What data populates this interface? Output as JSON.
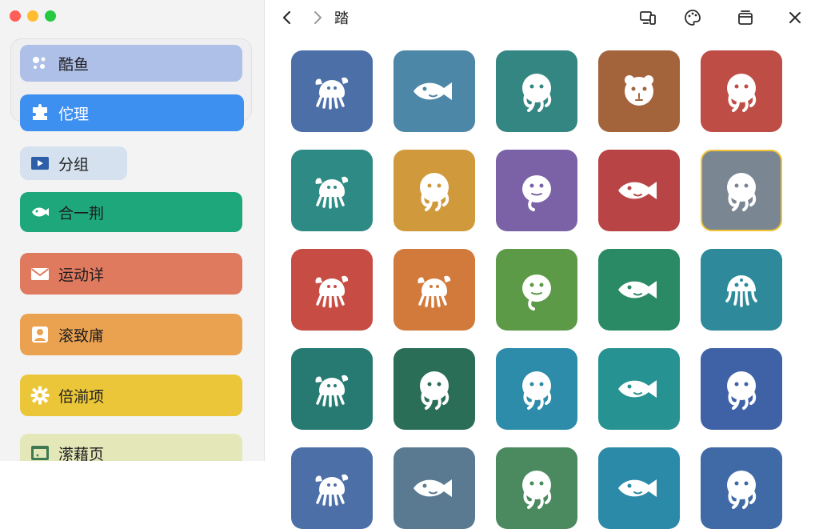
{
  "window": {
    "title": "踏"
  },
  "toolbar": {
    "back_icon": "chevron-left-icon",
    "forward_icon": "chevron-right-icon",
    "title": "踏",
    "actions": [
      {
        "name": "devices-icon"
      },
      {
        "name": "palette-icon"
      },
      {
        "name": "window-icon"
      },
      {
        "name": "close-icon"
      }
    ]
  },
  "sidebar": {
    "items": [
      {
        "label": "酷鱼",
        "icon": "dots-icon",
        "color": "#aec0e8",
        "selected": false
      },
      {
        "label": "佗理",
        "icon": "puzzle-icon",
        "color": "#3d8ff0",
        "selected": true
      },
      {
        "label": "分组",
        "icon": "video-icon",
        "color": "#d5e1ee",
        "selected": false
      },
      {
        "label": "合一荆",
        "icon": "fish-icon",
        "color": "#1fa77c",
        "selected": false
      },
      {
        "label": "运动详",
        "icon": "mail-icon",
        "color": "#e07a5f",
        "selected": false
      },
      {
        "label": "滚致庯",
        "icon": "person-icon",
        "color": "#eba250",
        "selected": false
      },
      {
        "label": "倍湔项",
        "icon": "gear-icon",
        "color": "#ebc638",
        "selected": false
      },
      {
        "label": "潆藉页",
        "icon": "screen-icon",
        "color": "#e4e8b8",
        "selected": false
      }
    ]
  },
  "grid": {
    "tiles": [
      {
        "creature": "crab-icon",
        "color": "#4d6fa8"
      },
      {
        "creature": "fish-icon",
        "color": "#4d87a8"
      },
      {
        "creature": "octopus-icon",
        "color": "#348682"
      },
      {
        "creature": "bear-icon",
        "color": "#a3643c"
      },
      {
        "creature": "octopus-icon",
        "color": "#bd4d45"
      },
      {
        "creature": "crab-icon",
        "color": "#2e8a84"
      },
      {
        "creature": "octopus-icon",
        "color": "#d09a3c"
      },
      {
        "creature": "blob-icon",
        "color": "#7b62a6"
      },
      {
        "creature": "fish-icon",
        "color": "#b84445"
      },
      {
        "creature": "octopus-icon",
        "color": "#7a8793",
        "selected": true
      },
      {
        "creature": "crab-icon",
        "color": "#c74d44"
      },
      {
        "creature": "crab-icon",
        "color": "#d27a3c"
      },
      {
        "creature": "blob-icon",
        "color": "#5c9a48"
      },
      {
        "creature": "fish-icon",
        "color": "#2a8a66"
      },
      {
        "creature": "jellyfish-icon",
        "color": "#2e8a9a"
      },
      {
        "creature": "crab-icon",
        "color": "#267a72"
      },
      {
        "creature": "octopus-icon",
        "color": "#2a6e58"
      },
      {
        "creature": "octopus-icon",
        "color": "#2c8caa"
      },
      {
        "creature": "fish-icon",
        "color": "#279292"
      },
      {
        "creature": "octopus-icon",
        "color": "#3f62a6"
      },
      {
        "creature": "crab-icon",
        "color": "#4d6fa8"
      },
      {
        "creature": "fish-icon",
        "color": "#5a7a92"
      },
      {
        "creature": "octopus-icon",
        "color": "#4a8a5e"
      },
      {
        "creature": "fish-icon",
        "color": "#2a8aa8"
      },
      {
        "creature": "octopus-icon",
        "color": "#3f6aa6"
      }
    ]
  }
}
